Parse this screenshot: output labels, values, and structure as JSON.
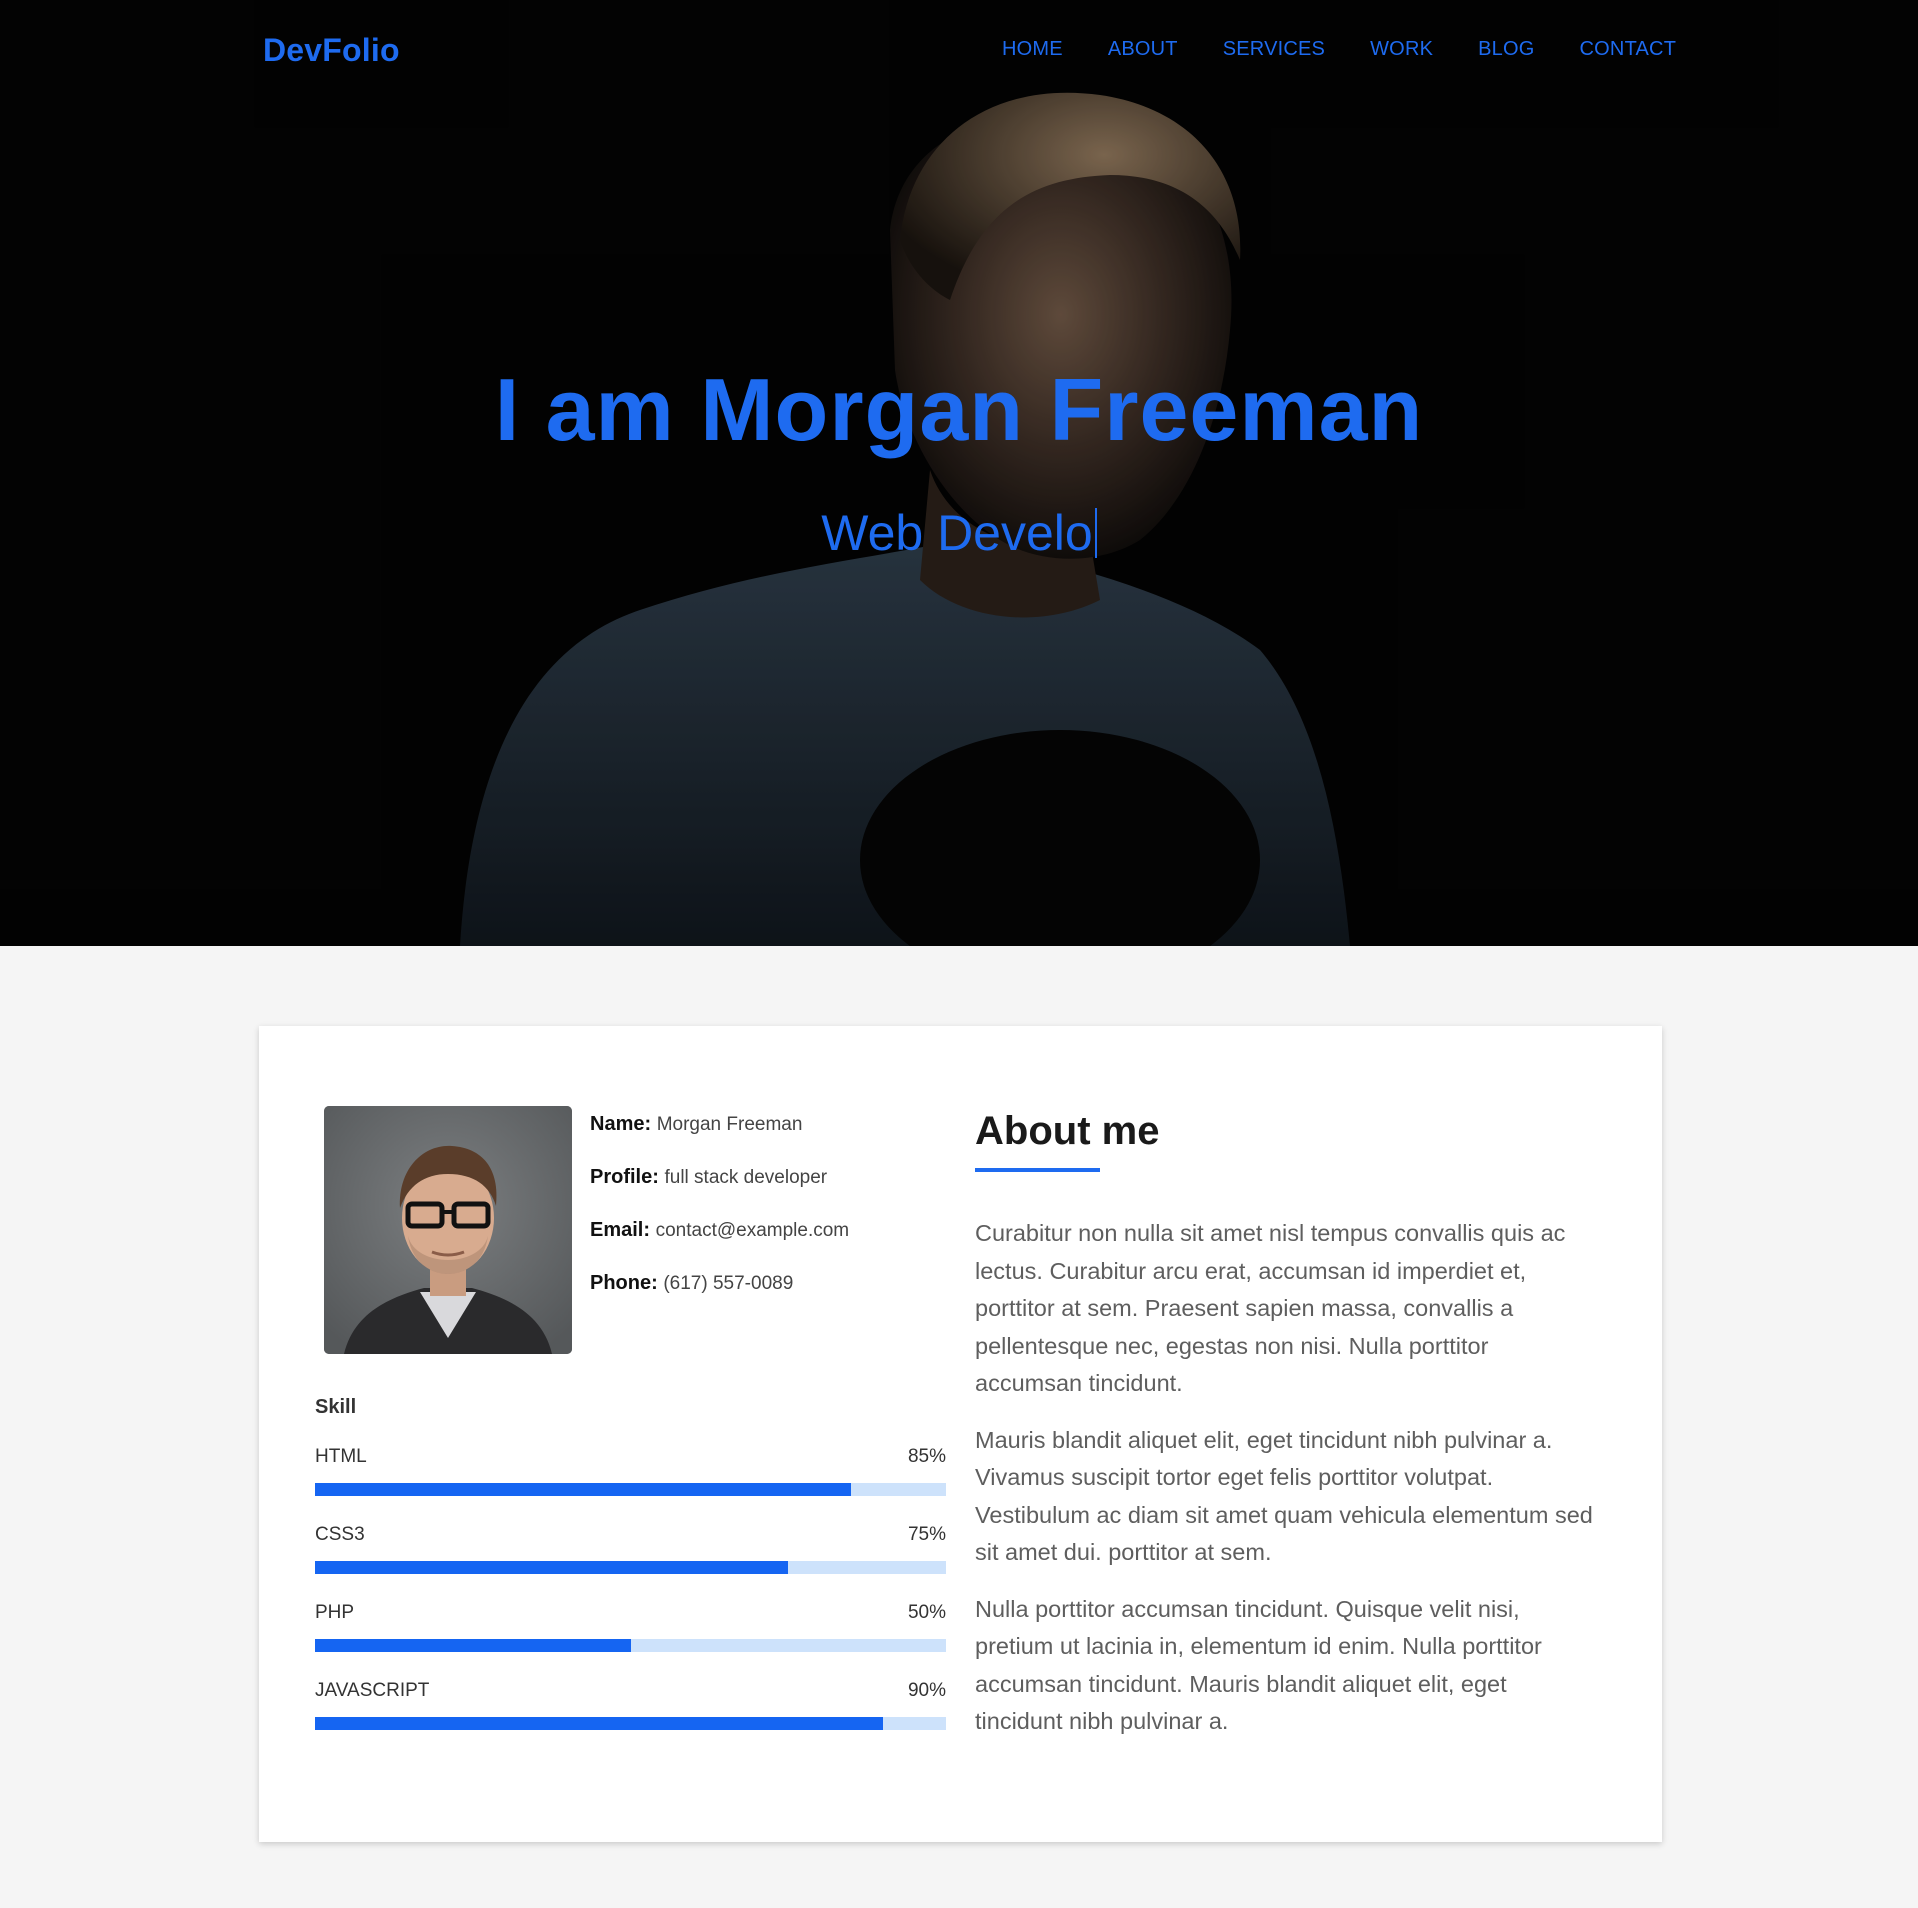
{
  "nav": {
    "logo": "DevFolio",
    "links": [
      "HOME",
      "ABOUT",
      "SERVICES",
      "WORK",
      "BLOG",
      "CONTACT"
    ]
  },
  "hero": {
    "title": "I am Morgan Freeman",
    "subtitle": "Web Develo"
  },
  "profile": {
    "name_label": "Name:",
    "name_value": "Morgan Freeman",
    "profile_label": "Profile:",
    "profile_value": "full stack developer",
    "email_label": "Email:",
    "email_value": "contact@example.com",
    "phone_label": "Phone:",
    "phone_value": "(617) 557-0089"
  },
  "skills": {
    "heading": "Skill",
    "items": [
      {
        "name": "HTML",
        "percent_label": "85%",
        "percent": 85
      },
      {
        "name": "CSS3",
        "percent_label": "75%",
        "percent": 75
      },
      {
        "name": "PHP",
        "percent_label": "50%",
        "percent": 50
      },
      {
        "name": "JAVASCRIPT",
        "percent_label": "90%",
        "percent": 90
      }
    ]
  },
  "about": {
    "title": "About me",
    "paragraphs": [
      "Curabitur non nulla sit amet nisl tempus convallis quis ac lectus. Curabitur arcu erat, accumsan id imperdiet et, porttitor at sem. Praesent sapien massa, convallis a pellentesque nec, egestas non nisi. Nulla porttitor accumsan tincidunt.",
      "Mauris blandit aliquet elit, eget tincidunt nibh pulvinar a. Vivamus suscipit tortor eget felis porttitor volutpat. Vestibulum ac diam sit amet quam vehicula elementum sed sit amet dui. porttitor at sem.",
      "Nulla porttitor accumsan tincidunt. Quisque velit nisi, pretium ut lacinia in, elementum id enim. Nulla porttitor accumsan tincidunt. Mauris blandit aliquet elit, eget tincidunt nibh pulvinar a."
    ]
  },
  "colors": {
    "accent": "#1e6bf0",
    "progress_fill": "#1565f2",
    "progress_track": "#cde2fb",
    "hero_bg": "#030303",
    "page_bg": "#f5f5f5"
  }
}
